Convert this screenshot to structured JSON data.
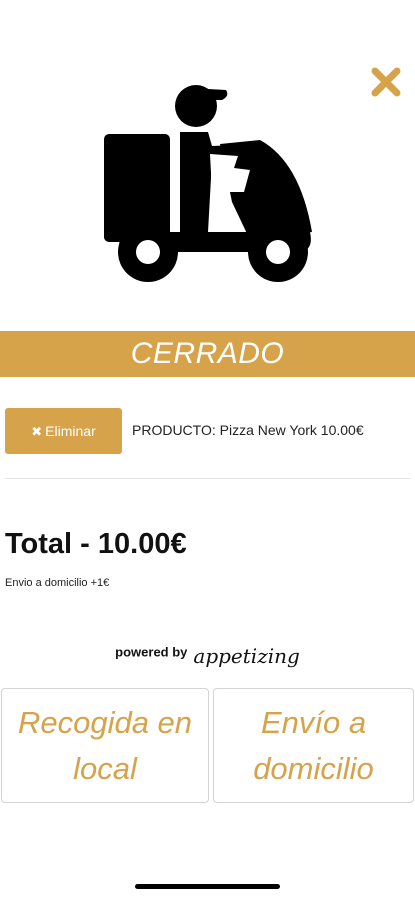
{
  "status": {
    "label": "CERRADO"
  },
  "cart": {
    "remove_label": "Eliminar",
    "product_line": "PRODUCTO: Pizza New York 10.00€"
  },
  "summary": {
    "total_label": "Total - 10.00€",
    "shipping_note": "Envio a domicilio +1€"
  },
  "branding": {
    "powered_by": "powered by",
    "brand_name": "appetizing"
  },
  "delivery_options": {
    "pickup_label": "Recogida en local",
    "delivery_label": "Envío a domicilio"
  },
  "icons": {
    "close": "close-icon",
    "hero": "delivery-scooter-icon",
    "remove": "x-icon"
  },
  "colors": {
    "accent": "#d6a24a",
    "text": "#111111",
    "background": "#ffffff"
  }
}
